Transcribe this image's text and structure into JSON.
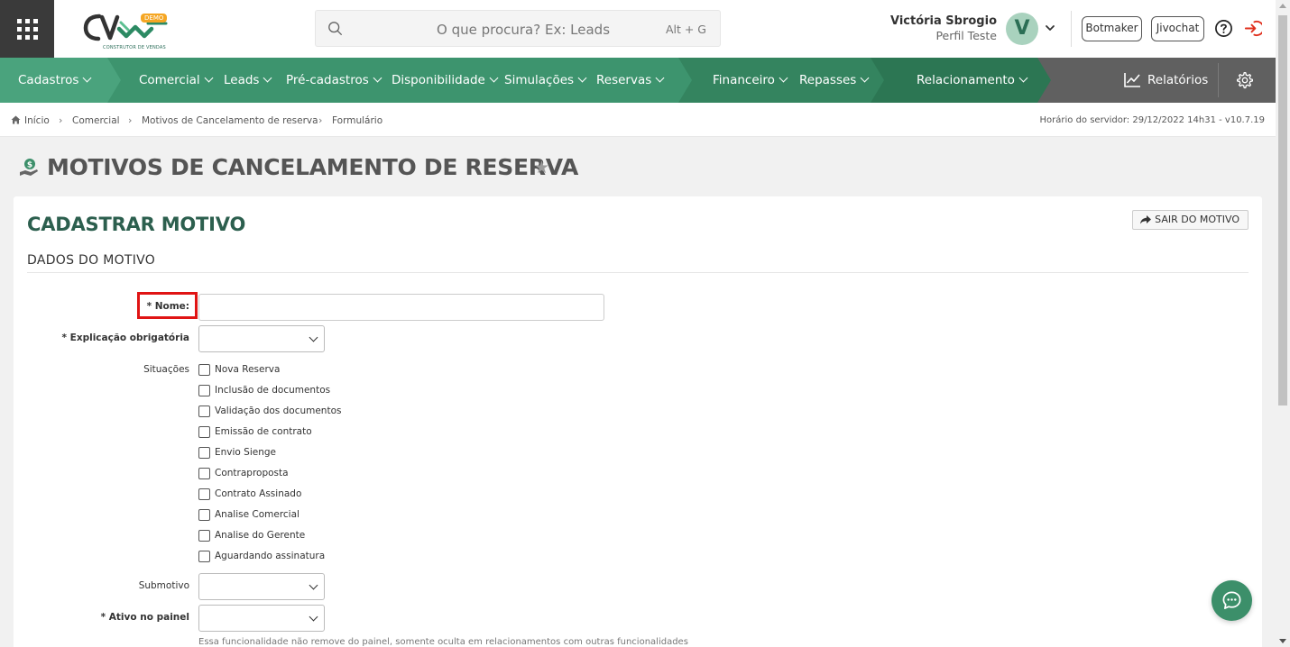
{
  "header": {
    "apps_icon": "grid-icon",
    "logo_text": "CONSTRUTOR DE VENDAS",
    "logo_badge": "DEMO",
    "search_placeholder": "O que procura? Ex: Leads",
    "search_shortcut": "Alt + G",
    "user_name": "Victória Sbrogio",
    "user_profile": "Perfil Teste",
    "avatar_initial": "V",
    "botmaker": "Botmaker",
    "jivochat": "Jivochat"
  },
  "nav": {
    "items": [
      "Cadastros",
      "Comercial",
      "Leads",
      "Pré-cadastros",
      "Disponibilidade",
      "Simulações",
      "Reservas",
      "Financeiro",
      "Repasses",
      "Relacionamento"
    ],
    "reports": "Relatórios",
    "colors": {
      "segment1": "#4aa37d",
      "segment2": "#3d946e",
      "segment3": "#34845f",
      "segment4": "#2c7653",
      "rest": "#606060"
    }
  },
  "breadcrumb": {
    "items": [
      "Início",
      "Comercial",
      "Motivos de Cancelamento de reserva",
      "Formulário"
    ],
    "server_time": "Horário do servidor: 29/12/2022 14h31 - v10.7.19"
  },
  "page": {
    "title": "MOTIVOS DE CANCELAMENTO DE RESERVA",
    "card_title": "CADASTRAR MOTIVO",
    "exit_button": "SAIR DO MOTIVO",
    "section_title": "DADOS DO MOTIVO"
  },
  "form": {
    "nome_label": "* Nome:",
    "nome_value": "",
    "explicacao_label": "* Explicação obrigatória",
    "situacoes_label": "Situações",
    "situacoes": [
      "Nova Reserva",
      "Inclusão de documentos",
      "Validação dos documentos",
      "Emissão de contrato",
      "Envio Sienge",
      "Contraproposta",
      "Contrato Assinado",
      "Analise Comercial",
      "Analise do Gerente",
      "Aguardando assinatura"
    ],
    "submotivo_label": "Submotivo",
    "ativo_label": "* Ativo no painel",
    "ativo_hint": "Essa funcionalidade não remove do painel, somente oculta em relacionamentos com outras funcionalidades"
  },
  "accent": "#2c5f4e",
  "highlight_color": "#e01414"
}
